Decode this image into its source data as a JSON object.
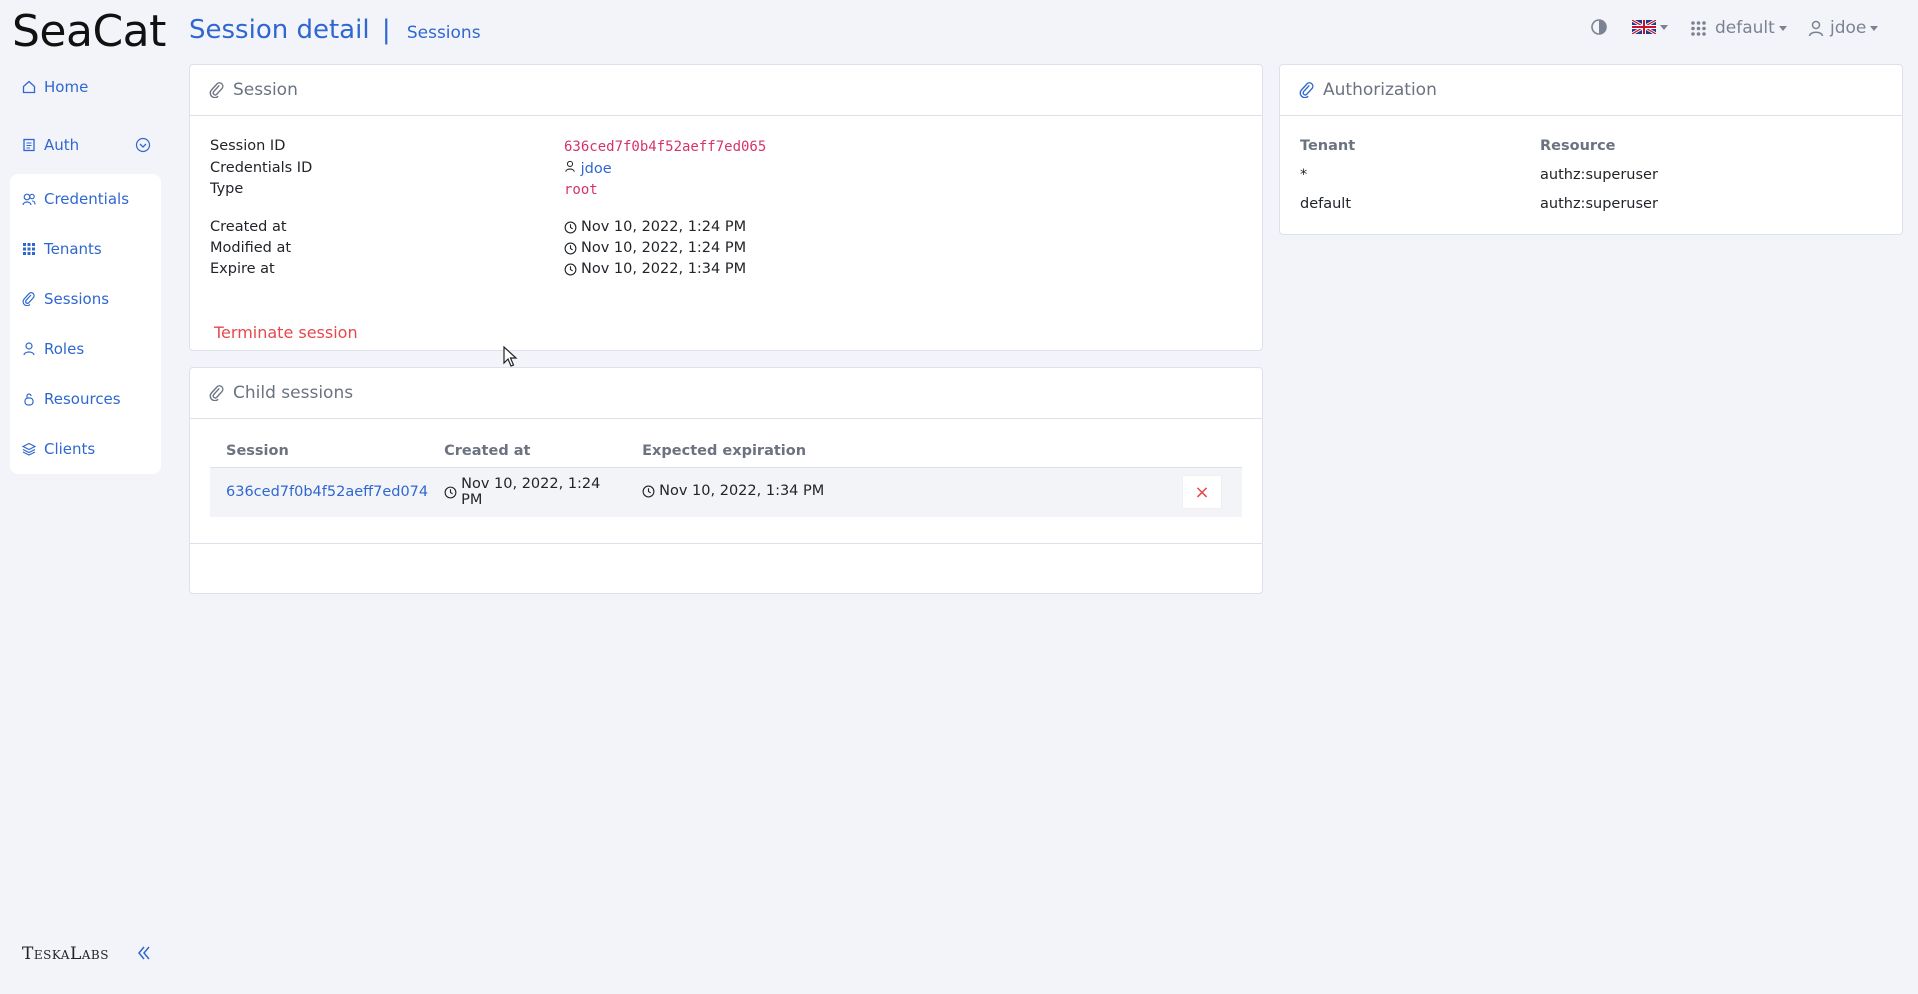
{
  "app": {
    "brand": "SeaCat",
    "footer_brand": "TeskaLabs"
  },
  "header": {
    "title": "Session detail",
    "separator": "|",
    "breadcrumb": "Sessions"
  },
  "topbar": {
    "tenant": "default",
    "user": "jdoe"
  },
  "sidebar": {
    "items": [
      {
        "label": "Home",
        "icon": "home-icon"
      },
      {
        "label": "Auth",
        "icon": "auth-icon"
      },
      {
        "label": "Credentials",
        "icon": "credentials-icon"
      },
      {
        "label": "Tenants",
        "icon": "grid-icon"
      },
      {
        "label": "Sessions",
        "icon": "paperclip-icon"
      },
      {
        "label": "Roles",
        "icon": "person-icon"
      },
      {
        "label": "Resources",
        "icon": "resource-icon"
      },
      {
        "label": "Clients",
        "icon": "stack-icon"
      }
    ]
  },
  "session": {
    "header": "Session",
    "fields": {
      "session_id_label": "Session ID",
      "session_id": "636ced7f0b4f52aeff7ed065",
      "credentials_label": "Credentials ID",
      "credentials": "jdoe",
      "type_label": "Type",
      "type": "root",
      "created_label": "Created at",
      "created": "Nov 10, 2022, 1:24 PM",
      "modified_label": "Modified at",
      "modified": "Nov 10, 2022, 1:24 PM",
      "expire_label": "Expire at",
      "expire": "Nov 10, 2022, 1:34 PM"
    },
    "terminate_label": "Terminate session"
  },
  "child_sessions": {
    "header": "Child sessions",
    "columns": [
      "Session",
      "Created at",
      "Expected expiration"
    ],
    "rows": [
      {
        "session": "636ced7f0b4f52aeff7ed074",
        "created": "Nov 10, 2022, 1:24 PM",
        "expiration": "Nov 10, 2022, 1:34 PM"
      }
    ],
    "delete_label": "×"
  },
  "authorization": {
    "header": "Authorization",
    "columns": [
      "Tenant",
      "Resource"
    ],
    "rows": [
      {
        "tenant": "*",
        "resource": "authz:superuser"
      },
      {
        "tenant": "default",
        "resource": "authz:superuser"
      }
    ]
  },
  "colors": {
    "accent": "#2f67d1",
    "danger": "#e5484d",
    "code": "#d6336c"
  }
}
